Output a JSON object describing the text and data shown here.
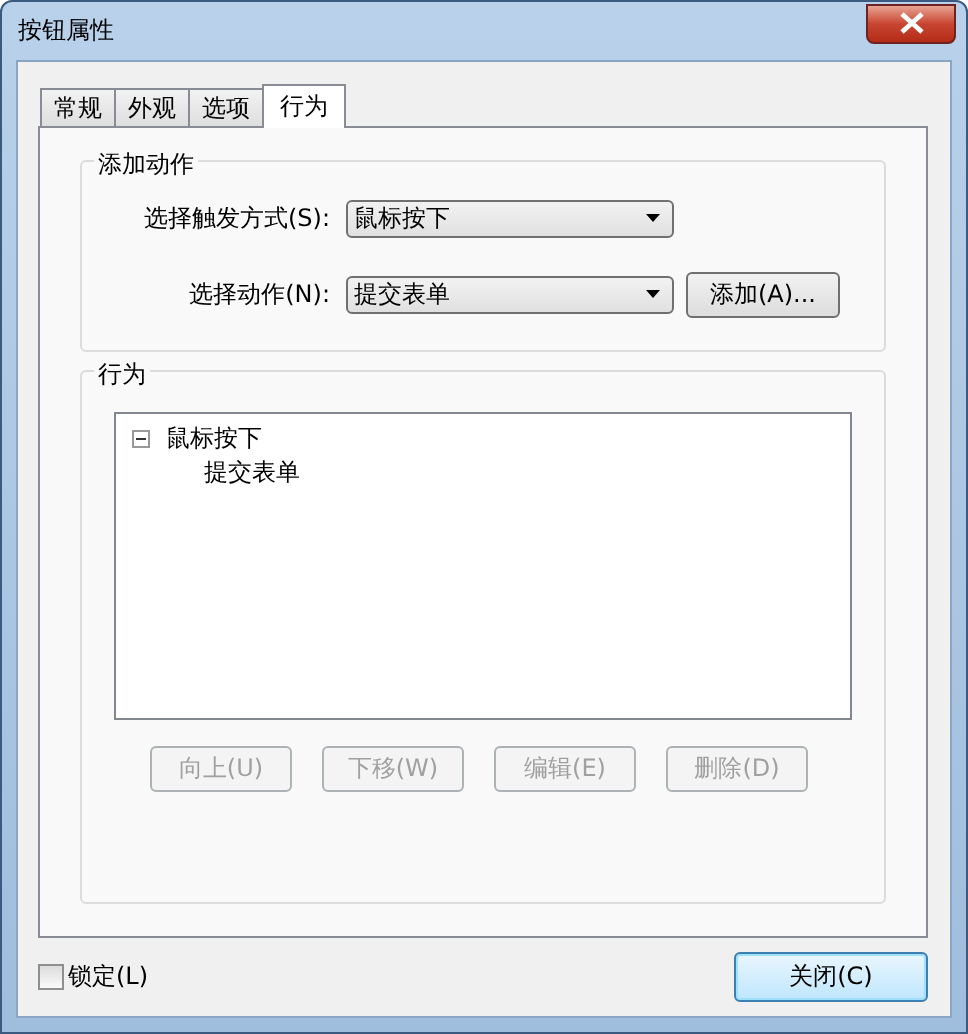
{
  "window": {
    "title": "按钮属性"
  },
  "tabs": [
    {
      "label": "常规",
      "selected": false
    },
    {
      "label": "外观",
      "selected": false
    },
    {
      "label": "选项",
      "selected": false
    },
    {
      "label": "行为",
      "selected": true
    }
  ],
  "add_action": {
    "title": "添加动作",
    "trigger": {
      "label": "选择触发方式(S):",
      "value": "鼠标按下"
    },
    "action": {
      "label": "选择动作(N):",
      "value": "提交表单"
    },
    "add_button": "添加(A)..."
  },
  "behavior": {
    "title": "行为",
    "tree": [
      {
        "label": "鼠标按下",
        "expanded": true,
        "children": [
          {
            "label": "提交表单"
          }
        ]
      }
    ],
    "buttons": [
      {
        "label": "向上(U)",
        "disabled": true
      },
      {
        "label": "下移(W)",
        "disabled": true
      },
      {
        "label": "编辑(E)",
        "disabled": true
      },
      {
        "label": "删除(D)",
        "disabled": true
      }
    ]
  },
  "lock": {
    "label": "锁定(L)",
    "checked": false
  },
  "close_button": "关闭(C)"
}
